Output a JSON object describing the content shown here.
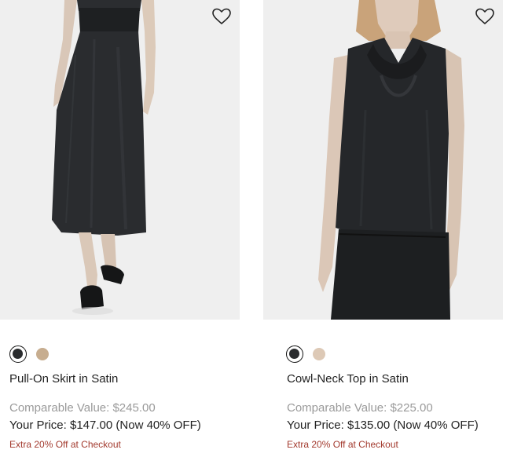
{
  "products": [
    {
      "name": "Pull-On Skirt in Satin",
      "comparable_label": "Comparable Value: ",
      "comparable_value": "$245.00",
      "your_price_label": "Your Price: ",
      "your_price": "$147.00",
      "discount": "(Now 40% OFF)",
      "promo": "Extra 20% Off at Checkout",
      "swatches": [
        {
          "color": "#2a2c2e",
          "selected": true
        },
        {
          "color": "#c7ad8f",
          "selected": false
        }
      ],
      "wishlist_icon": "heart-outline-icon"
    },
    {
      "name": "Cowl-Neck Top in Satin",
      "comparable_label": "Comparable Value: ",
      "comparable_value": "$225.00",
      "your_price_label": "Your Price: ",
      "your_price": "$135.00",
      "discount": "(Now 40% OFF)",
      "promo": "Extra 20% Off at Checkout",
      "swatches": [
        {
          "color": "#2a2c2e",
          "selected": true
        },
        {
          "color": "#ddc9b6",
          "selected": false
        }
      ],
      "wishlist_icon": "heart-outline-icon"
    }
  ],
  "colors": {
    "promo": "#a33b2f",
    "muted": "#9a9a9a",
    "image_bg": "#efefef"
  }
}
